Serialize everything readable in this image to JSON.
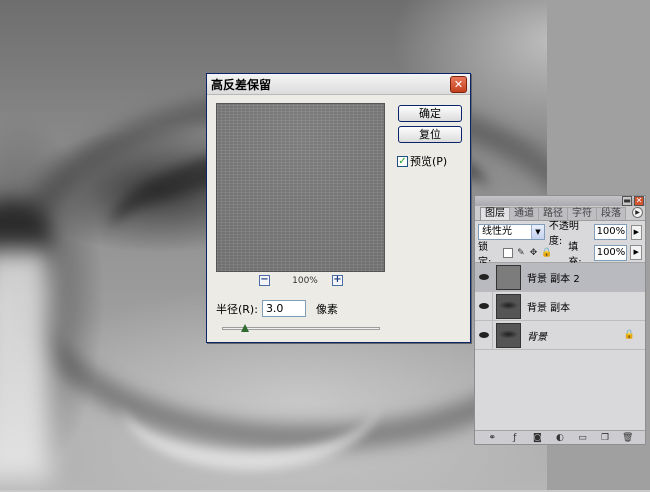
{
  "dialog": {
    "title": "高反差保留",
    "close_glyph": "✕",
    "ok_label": "确定",
    "reset_label": "复位",
    "preview_label": "预览(P)",
    "preview_checked": true,
    "check_glyph": "✓",
    "zoom_out_glyph": "−",
    "zoom_in_glyph": "+",
    "zoom_level": "100%",
    "radius_label": "半径(R):",
    "radius_value": "3.0",
    "radius_unit": "像素"
  },
  "layers_panel": {
    "tabs": [
      {
        "label": "图层",
        "active": true
      },
      {
        "label": "通道",
        "active": false
      },
      {
        "label": "路径",
        "active": false
      },
      {
        "label": "字符",
        "active": false
      },
      {
        "label": "段落",
        "active": false
      }
    ],
    "minimize_glyph": "▬",
    "close_glyph": "✕",
    "menu_glyph": "▶",
    "blend_mode": "线性光",
    "opacity_label": "不透明度:",
    "opacity_value": "100%",
    "lock_label": "锁定:",
    "fill_label": "填充:",
    "fill_value": "100%",
    "arrow_glyph": "▶",
    "dropdown_glyph": "▼",
    "lock_icons": [
      "◻",
      "✎",
      "✥",
      "🔒"
    ],
    "layers": [
      {
        "name": "背景 副本 2",
        "thumb": "gray",
        "active": true,
        "italic": false
      },
      {
        "name": "背景 副本",
        "thumb": "photo",
        "active": false,
        "italic": false
      },
      {
        "name": "背景",
        "thumb": "photo",
        "active": false,
        "italic": true,
        "locked": true,
        "lock_glyph": "🔒"
      }
    ],
    "footer_icons": [
      "link-icon",
      "fx-icon",
      "mask-icon",
      "adjustment-icon",
      "folder-icon",
      "new-layer-icon",
      "trash-icon"
    ],
    "footer_glyphs": [
      "⚭",
      "ƒ",
      "◙",
      "◐",
      "▭",
      "❐",
      "🗑"
    ]
  }
}
